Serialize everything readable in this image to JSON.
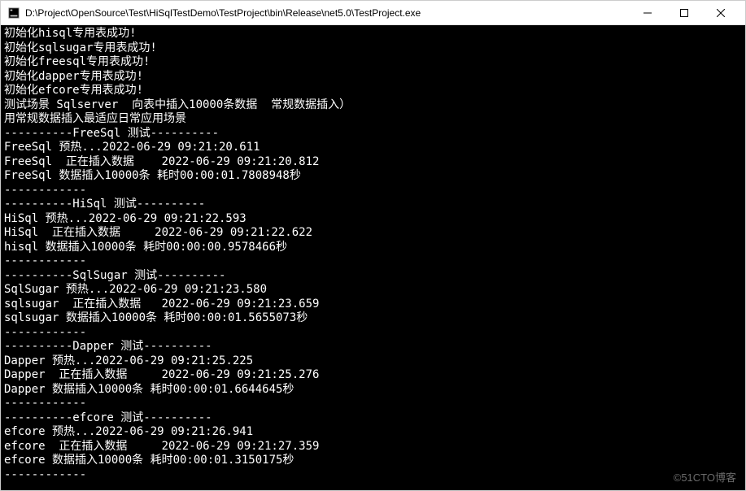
{
  "window": {
    "title": "D:\\Project\\OpenSource\\Test\\HiSqlTestDemo\\TestProject\\bin\\Release\\net5.0\\TestProject.exe"
  },
  "console": {
    "lines": [
      "初始化hisql专用表成功!",
      "初始化sqlsugar专用表成功!",
      "初始化freesql专用表成功!",
      "初始化dapper专用表成功!",
      "初始化efcore专用表成功!",
      "测试场景 Sqlserver  向表中插入10000条数据  常规数据插入）",
      "用常规数据插入最适应日常应用场景",
      "",
      "----------FreeSql 测试----------",
      "FreeSql 预热...2022-06-29 09:21:20.611",
      "FreeSql  正在插入数据    2022-06-29 09:21:20.812",
      "FreeSql 数据插入10000条 耗时00:00:01.7808948秒",
      "------------",
      "----------HiSql 测试----------",
      "HiSql 预热...2022-06-29 09:21:22.593",
      "HiSql  正在插入数据     2022-06-29 09:21:22.622",
      "hisql 数据插入10000条 耗时00:00:00.9578466秒",
      "------------",
      "----------SqlSugar 测试----------",
      "SqlSugar 预热...2022-06-29 09:21:23.580",
      "sqlsugar  正在插入数据   2022-06-29 09:21:23.659",
      "sqlsugar 数据插入10000条 耗时00:00:01.5655073秒",
      "------------",
      "----------Dapper 测试----------",
      "Dapper 预热...2022-06-29 09:21:25.225",
      "Dapper  正在插入数据     2022-06-29 09:21:25.276",
      "Dapper 数据插入10000条 耗时00:00:01.6644645秒",
      "------------",
      "----------efcore 测试----------",
      "efcore 预热...2022-06-29 09:21:26.941",
      "efcore  正在插入数据     2022-06-29 09:21:27.359",
      "efcore 数据插入10000条 耗时00:00:01.3150175秒",
      "------------"
    ]
  },
  "watermark": "©51CTO博客"
}
